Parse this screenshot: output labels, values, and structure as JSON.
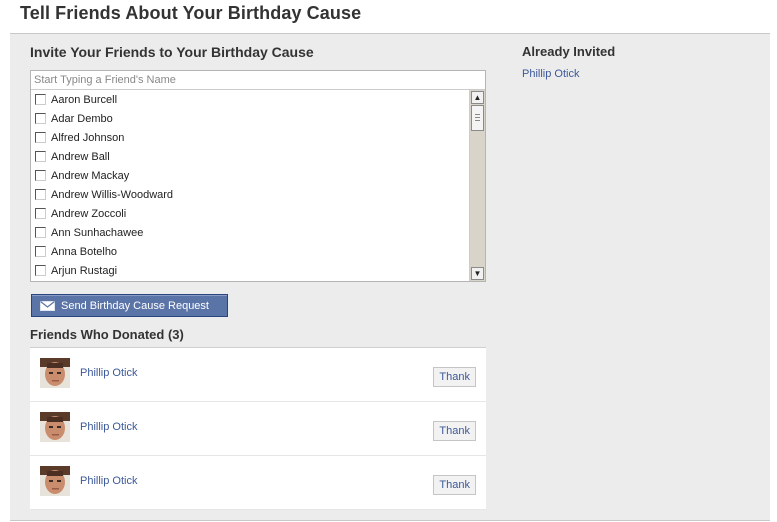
{
  "page": {
    "title": "Tell Friends About Your Birthday Cause"
  },
  "invite": {
    "heading": "Invite Your Friends to Your Birthday Cause",
    "search_placeholder": "Start Typing a Friend's Name",
    "friends": [
      "Aaron Burcell",
      "Adar Dembo",
      "Alfred Johnson",
      "Andrew Ball",
      "Andrew Mackay",
      "Andrew Willis-Woodward",
      "Andrew Zoccoli",
      "Ann Sunhachawee",
      "Anna Botelho",
      "Arjun Rustagi"
    ],
    "send_label": "Send Birthday Cause Request"
  },
  "already_invited": {
    "heading": "Already Invited",
    "names": [
      "Phillip Otick"
    ]
  },
  "donated": {
    "heading": "Friends Who Donated (3)",
    "donors": [
      {
        "name": "Phillip Otick",
        "thank_label": "Thank"
      },
      {
        "name": "Phillip Otick",
        "thank_label": "Thank"
      },
      {
        "name": "Phillip Otick",
        "thank_label": "Thank"
      }
    ]
  },
  "icons": {
    "send": "envelope-icon",
    "scroll_up": "arrow-up-icon",
    "scroll_down": "arrow-down-icon"
  },
  "colors": {
    "link": "#3b5998",
    "button_bg": "#5b74a8",
    "panel_bg": "#ececec"
  }
}
